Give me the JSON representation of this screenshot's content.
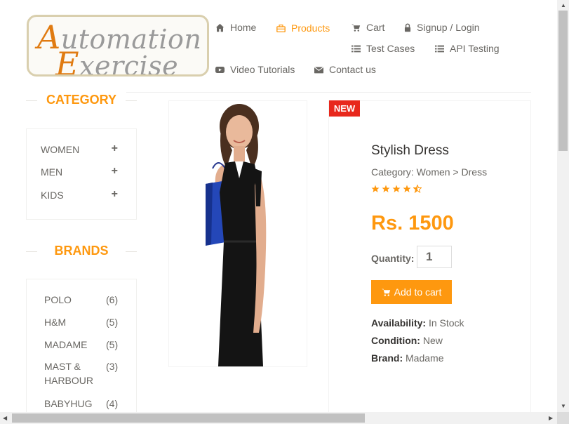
{
  "logo": {
    "line1_cap": "A",
    "line1_rest": "utomation",
    "line2_cap": "E",
    "line2_rest": "xercise"
  },
  "nav": {
    "home": "Home",
    "products": "Products",
    "cart": "Cart",
    "login": "Signup / Login",
    "test_cases": "Test Cases",
    "api_testing": "API Testing",
    "video_tutorials": "Video Tutorials",
    "contact_us": "Contact us"
  },
  "sidebar": {
    "category_title": "CATEGORY",
    "categories": [
      "WOMEN",
      "MEN",
      "KIDS"
    ],
    "brands_title": "BRANDS",
    "brands": [
      {
        "name": "POLO",
        "count": "(6)"
      },
      {
        "name": "H&M",
        "count": "(5)"
      },
      {
        "name": "MADAME",
        "count": "(5)"
      },
      {
        "name": "MAST & HARBOUR",
        "count": "(3)"
      },
      {
        "name": "BABYHUG",
        "count": "(4)"
      }
    ]
  },
  "product": {
    "badge": "NEW",
    "name": "Stylish Dress",
    "category": "Category: Women > Dress",
    "rating": 4.5,
    "price": "Rs. 1500",
    "quantity_label": "Quantity:",
    "quantity_value": "1",
    "add_to_cart": "Add to cart",
    "availability_label": "Availability:",
    "availability_value": "In Stock",
    "condition_label": "Condition:",
    "condition_value": "New",
    "brand_label": "Brand:",
    "brand_value": "Madame"
  },
  "colors": {
    "accent": "#FE980F",
    "badge": "#E8281C",
    "text": "#696763"
  }
}
